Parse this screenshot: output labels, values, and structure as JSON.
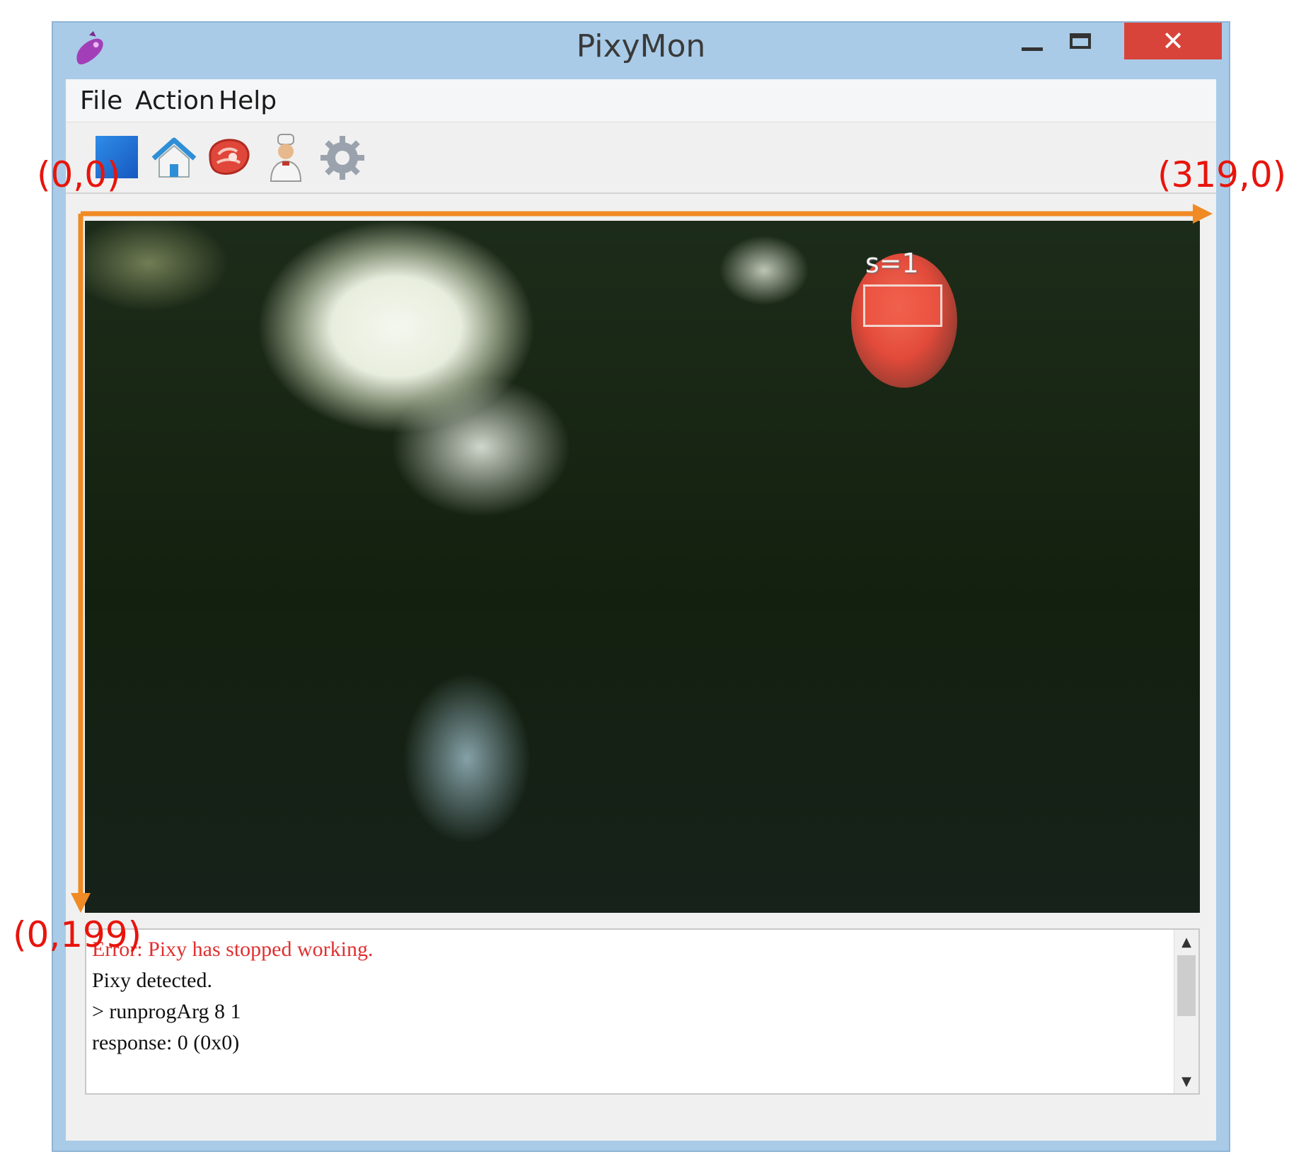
{
  "window": {
    "title": "PixyMon",
    "close_glyph": "✕",
    "accent_close": "#d9443a"
  },
  "menu": {
    "items": [
      "File",
      "Action",
      "Help"
    ]
  },
  "toolbar": {
    "icons": [
      "stop-icon",
      "home-icon",
      "raw-meat-icon",
      "cook-icon",
      "gear-icon"
    ]
  },
  "video": {
    "block_label": "s=1"
  },
  "console": {
    "lines": [
      {
        "text": "Error: Pixy has stopped working.",
        "style": "error"
      },
      {
        "text": "Pixy detected.",
        "style": "normal"
      },
      {
        "text": "> runprogArg 8 1",
        "style": "normal"
      },
      {
        "text": "response: 0 (0x0)",
        "style": "normal"
      }
    ]
  },
  "annotations": {
    "origin_label": "(0,0)",
    "x_max_label": "(319,0)",
    "y_max_label": "(0,199)",
    "arrow_color": "#f08a24",
    "label_color": "#e8140c"
  }
}
